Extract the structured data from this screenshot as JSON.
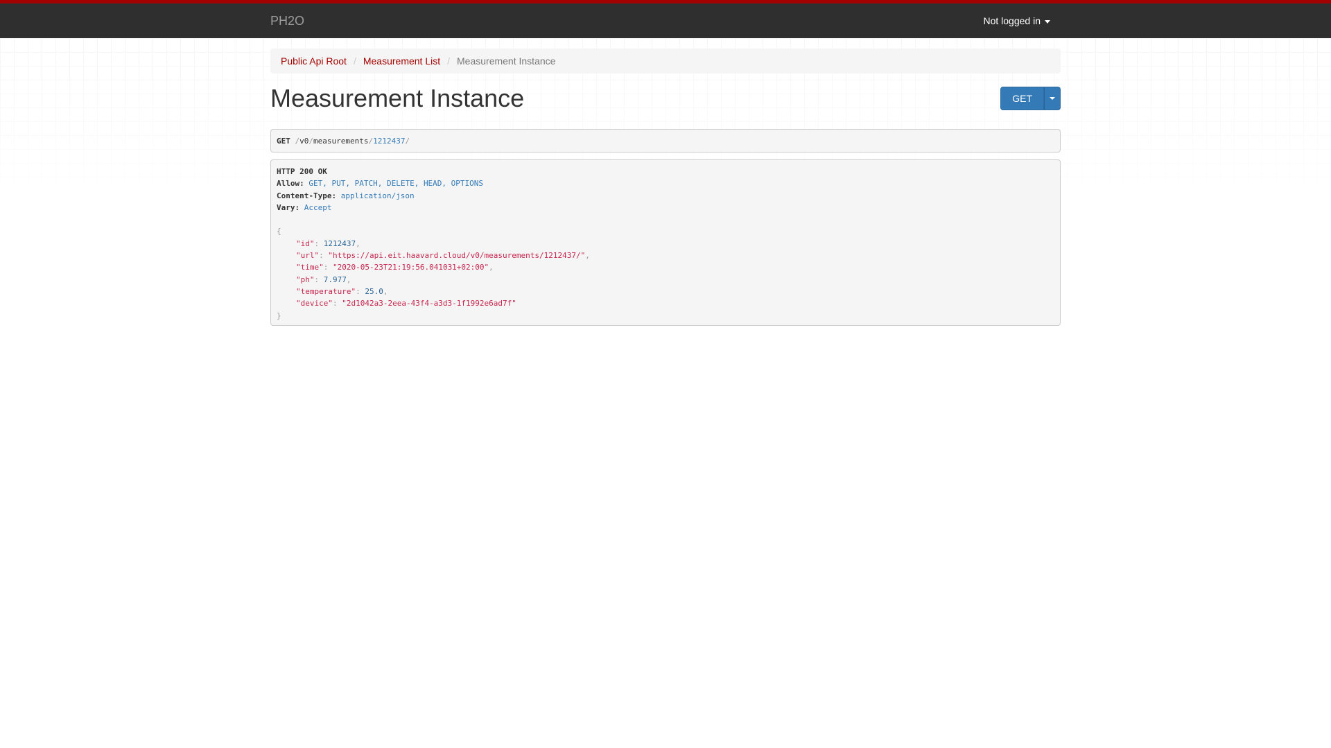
{
  "navbar": {
    "brand": "PH2O",
    "user_menu": "Not logged in"
  },
  "breadcrumb": {
    "items": [
      "Public Api Root",
      "Measurement List",
      "Measurement Instance"
    ]
  },
  "page": {
    "title": "Measurement Instance",
    "get_button": "GET"
  },
  "request": {
    "method": "GET",
    "path_parts": [
      "v0",
      "measurements",
      "1212437"
    ]
  },
  "response": {
    "status": "HTTP 200 OK",
    "headers": [
      {
        "name": "Allow:",
        "value": "GET, PUT, PATCH, DELETE, HEAD, OPTIONS"
      },
      {
        "name": "Content-Type:",
        "value": "application/json"
      },
      {
        "name": "Vary:",
        "value": "Accept"
      }
    ],
    "body": {
      "open_brace": "{",
      "close_brace": "}",
      "fields": [
        {
          "key": "\"id\"",
          "value": "1212437",
          "type": "number"
        },
        {
          "key": "\"url\"",
          "value": "\"https://api.eit.haavard.cloud/v0/measurements/1212437/\"",
          "type": "string"
        },
        {
          "key": "\"time\"",
          "value": "\"2020-05-23T21:19:56.041031+02:00\"",
          "type": "string"
        },
        {
          "key": "\"ph\"",
          "value": "7.977",
          "type": "number"
        },
        {
          "key": "\"temperature\"",
          "value": "25.0",
          "type": "number"
        },
        {
          "key": "\"device\"",
          "value": "\"2d1042a3-2eea-43f4-a3d3-1f1992e6ad7f\"",
          "type": "string"
        }
      ]
    }
  },
  "colors": {
    "accent": "#a30000",
    "navbar": "#2f2f2f",
    "primary": "#337ab7"
  }
}
